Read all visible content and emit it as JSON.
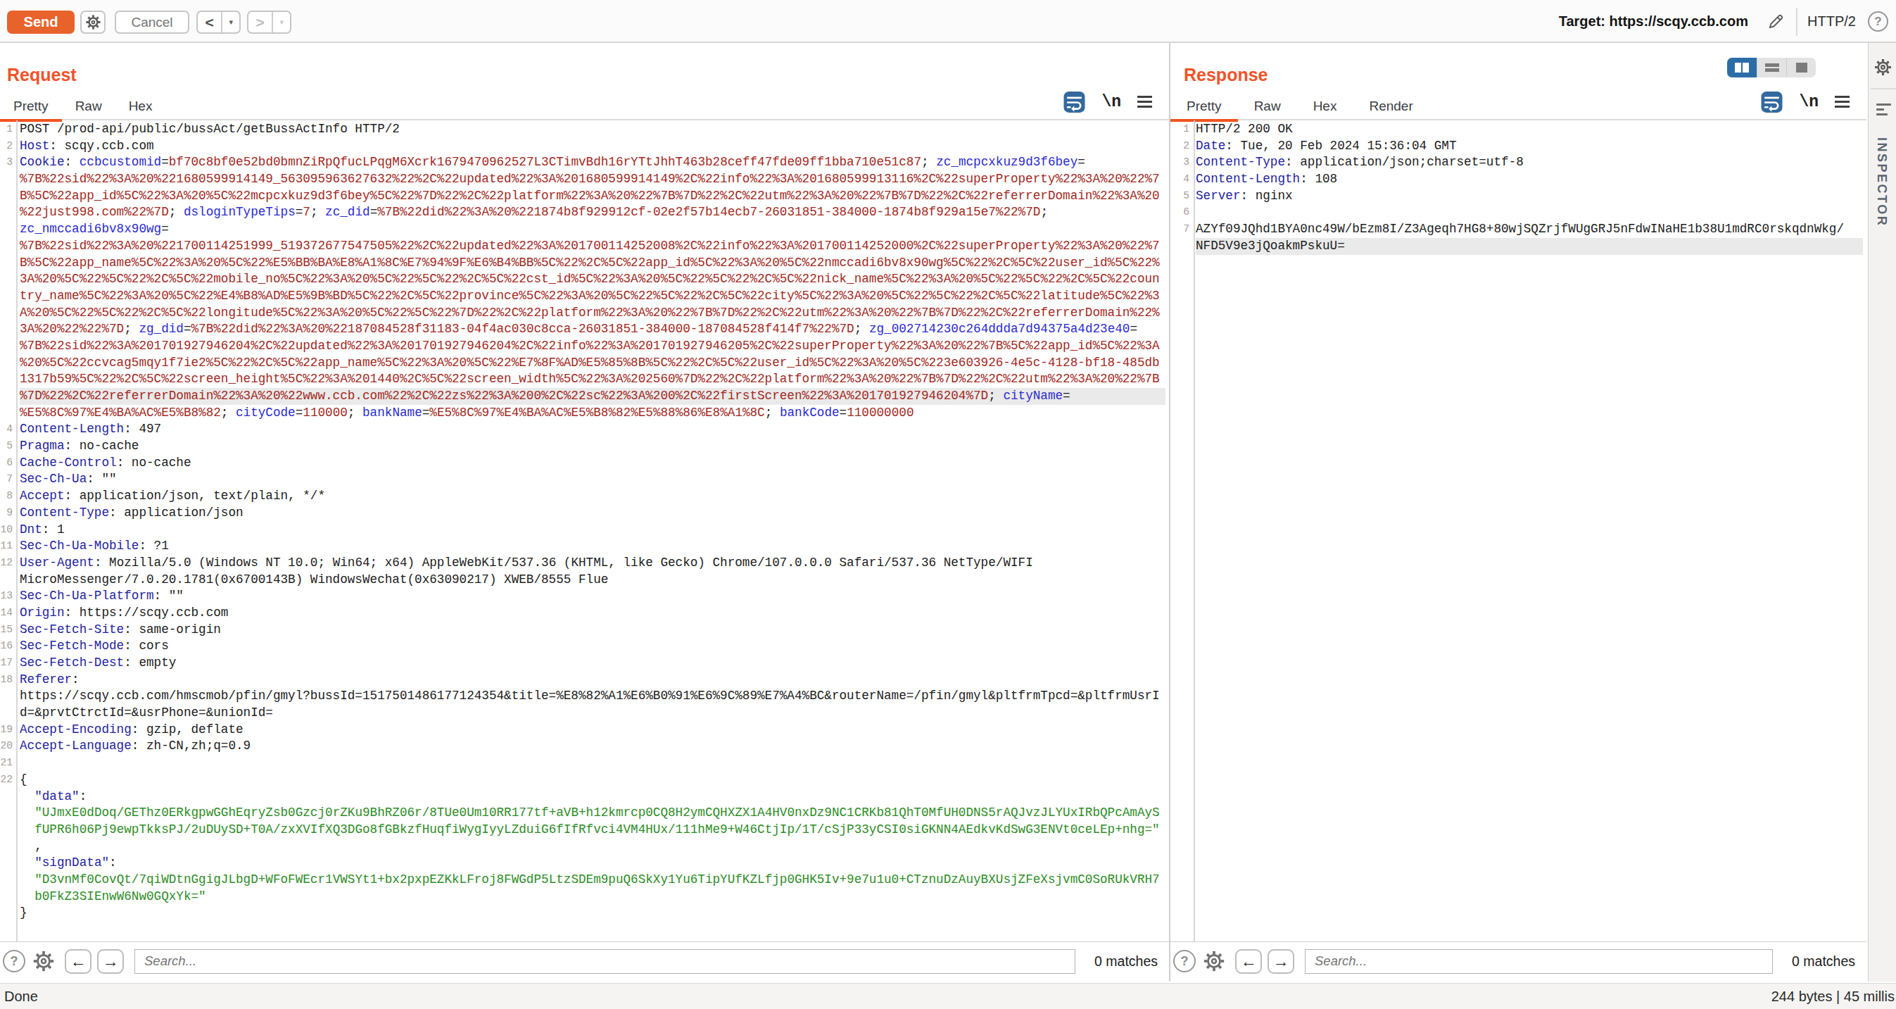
{
  "colors": {
    "accent_orange": "#f0542a",
    "send_button": "#e8632c",
    "tab_underline": "#f2551f",
    "active_toggle_blue": "#2c6da6",
    "wrap_icon_blue": "#33699d",
    "header_name_blue": "#24249f",
    "cookie_name_blue": "#2b2bd0",
    "value_red": "#a3291e",
    "string_green": "#2e8d27",
    "row_highlight": "#eaeaea"
  },
  "toolbar": {
    "send_label": "Send",
    "cancel_label": "Cancel",
    "back_glyph": "<",
    "forward_glyph": ">",
    "caret_glyph": "▾",
    "target_label": "Target: https://scqy.ccb.com",
    "protocol": "HTTP/2",
    "help_glyph": "?"
  },
  "inspector": {
    "label": "INSPECTOR"
  },
  "search": {
    "placeholder": "Search...",
    "matches": "0 matches",
    "help_glyph": "?",
    "prev_glyph": "←",
    "next_glyph": "→"
  },
  "status": {
    "left": "Done",
    "right": "244 bytes | 45 millis"
  },
  "request": {
    "title": "Request",
    "tabs": [
      "Pretty",
      "Raw",
      "Hex"
    ],
    "active_tab": "Pretty",
    "nl_icon": "\\n",
    "lines": [
      {
        "num": "1",
        "rows": [
          [
            {
              "c": "t",
              "x": "POST /prod-api/public/bussAct/getBussActInfo HTTP/2"
            }
          ]
        ]
      },
      {
        "num": "2",
        "rows": [
          [
            {
              "c": "h",
              "x": "Host"
            },
            {
              "c": "t",
              "x": ": scqy.ccb.com"
            }
          ]
        ]
      },
      {
        "num": "3",
        "rows": [
          [
            {
              "c": "h",
              "x": "Cookie"
            },
            {
              "c": "t",
              "x": ": "
            },
            {
              "c": "k",
              "x": "ccbcustomid"
            },
            {
              "c": "t",
              "x": "="
            },
            {
              "c": "v",
              "x": "bf70c8bf0e52bd0bmnZiRpQfucLPqgM6Xcrk1679470962527L3CTimvBdh16rYTtJhhT463b28ceff47fde09ff1bba710e51c87"
            },
            {
              "c": "t",
              "x": "; "
            },
            {
              "c": "k",
              "x": "zc_mcpcxkuz9d3f6bey"
            },
            {
              "c": "t",
              "x": "="
            }
          ],
          [
            {
              "c": "v",
              "x": "%7B%22sid%22%3A%20%221680599914149_563095963627632%22%2C%22updated%22%3A%201680599914149%2C%22info%22%3A%201680599913116%2C%22superProperty%22%3A%20%22%7"
            }
          ],
          [
            {
              "c": "v",
              "x": "B%5C%22app_id%5C%22%3A%20%5C%22mcpcxkuz9d3f6bey%5C%22%7D%22%2C%22platform%22%3A%20%22%7B%7D%22%2C%22utm%22%3A%20%22%7B%7D%22%2C%22referrerDomain%22%3A%20"
            }
          ],
          [
            {
              "c": "v",
              "x": "%22just998.com%22%7D"
            },
            {
              "c": "t",
              "x": "; "
            },
            {
              "c": "k",
              "x": "dsloginTypeTips"
            },
            {
              "c": "t",
              "x": "="
            },
            {
              "c": "v",
              "x": "7"
            },
            {
              "c": "t",
              "x": "; "
            },
            {
              "c": "k",
              "x": "zc_did"
            },
            {
              "c": "t",
              "x": "="
            },
            {
              "c": "v",
              "x": "%7B%22did%22%3A%20%221874b8f929912cf-02e2f57b14ecb7-26031851-384000-1874b8f929a15e7%22%7D"
            },
            {
              "c": "t",
              "x": ";"
            }
          ],
          [
            {
              "c": "k",
              "x": "zc_nmccadi6bv8x90wg"
            },
            {
              "c": "t",
              "x": "="
            }
          ],
          [
            {
              "c": "v",
              "x": "%7B%22sid%22%3A%20%221700114251999_519372677547505%22%2C%22updated%22%3A%201700114252008%2C%22info%22%3A%201700114252000%2C%22superProperty%22%3A%20%22%7"
            }
          ],
          [
            {
              "c": "v",
              "x": "B%5C%22app_name%5C%22%3A%20%5C%22%E5%BB%BA%E8%A1%8C%E7%94%9F%E6%B4%BB%5C%22%2C%5C%22app_id%5C%22%3A%20%5C%22nmccadi6bv8x90wg%5C%22%2C%5C%22user_id%5C%22%"
            }
          ],
          [
            {
              "c": "v",
              "x": "3A%20%5C%22%5C%22%2C%5C%22mobile_no%5C%22%3A%20%5C%22%5C%22%2C%5C%22cst_id%5C%22%3A%20%5C%22%5C%22%2C%5C%22nick_name%5C%22%3A%20%5C%22%5C%22%2C%5C%22coun"
            }
          ],
          [
            {
              "c": "v",
              "x": "try_name%5C%22%3A%20%5C%22%E4%B8%AD%E5%9B%BD%5C%22%2C%5C%22province%5C%22%3A%20%5C%22%5C%22%2C%5C%22city%5C%22%3A%20%5C%22%5C%22%2C%5C%22latitude%5C%22%3"
            }
          ],
          [
            {
              "c": "v",
              "x": "A%20%5C%22%5C%22%2C%5C%22longitude%5C%22%3A%20%5C%22%5C%22%7D%22%2C%22platform%22%3A%20%22%7B%7D%22%2C%22utm%22%3A%20%22%7B%7D%22%2C%22referrerDomain%22%"
            }
          ],
          [
            {
              "c": "v",
              "x": "3A%20%22%22%7D"
            },
            {
              "c": "t",
              "x": "; "
            },
            {
              "c": "k",
              "x": "zg_did"
            },
            {
              "c": "t",
              "x": "="
            },
            {
              "c": "v",
              "x": "%7B%22did%22%3A%20%22187084528f31183-04f4ac030c8cca-26031851-384000-187084528f414f7%22%7D"
            },
            {
              "c": "t",
              "x": "; "
            },
            {
              "c": "k",
              "x": "zg_002714230c264ddda7d94375a4d23e40"
            },
            {
              "c": "t",
              "x": "="
            }
          ],
          [
            {
              "c": "v",
              "x": "%7B%22sid%22%3A%201701927946204%2C%22updated%22%3A%201701927946204%2C%22info%22%3A%201701927946205%2C%22superProperty%22%3A%20%22%7B%5C%22app_id%5C%22%3A"
            }
          ],
          [
            {
              "c": "v",
              "x": "%20%5C%22ccvcag5mqy1f7ie2%5C%22%2C%5C%22app_name%5C%22%3A%20%5C%22%E7%8F%AD%E5%85%8B%5C%22%2C%5C%22user_id%5C%22%3A%20%5C%223e603926-4e5c-4128-bf18-485db"
            }
          ],
          [
            {
              "c": "v",
              "x": "1317b59%5C%22%2C%5C%22screen_height%5C%22%3A%201440%2C%5C%22screen_width%5C%22%3A%202560%7D%22%2C%22platform%22%3A%20%22%7B%7D%22%2C%22utm%22%3A%20%22%7B"
            }
          ],
          {
            "hl": true,
            "s": [
              {
                "c": "v",
                "x": "%7D%22%2C%22referrerDomain%22%3A%20%22www.ccb.com%22%2C%22zs%22%3A%200%2C%22sc%22%3A%200%2C%22firstScreen%22%3A%201701927946204%7D"
              },
              {
                "c": "t",
                "x": "; "
              },
              {
                "c": "k",
                "x": "cityName"
              },
              {
                "c": "t",
                "x": "="
              }
            ]
          },
          [
            {
              "c": "v",
              "x": "%E5%8C%97%E4%BA%AC%E5%B8%82"
            },
            {
              "c": "t",
              "x": "; "
            },
            {
              "c": "k",
              "x": "cityCode"
            },
            {
              "c": "t",
              "x": "="
            },
            {
              "c": "v",
              "x": "110000"
            },
            {
              "c": "t",
              "x": "; "
            },
            {
              "c": "k",
              "x": "bankName"
            },
            {
              "c": "t",
              "x": "="
            },
            {
              "c": "v",
              "x": "%E5%8C%97%E4%BA%AC%E5%B8%82%E5%88%86%E8%A1%8C"
            },
            {
              "c": "t",
              "x": "; "
            },
            {
              "c": "k",
              "x": "bankCode"
            },
            {
              "c": "t",
              "x": "="
            },
            {
              "c": "v",
              "x": "110000000"
            }
          ]
        ]
      },
      {
        "num": "4",
        "rows": [
          [
            {
              "c": "h",
              "x": "Content-Length"
            },
            {
              "c": "t",
              "x": ": 497"
            }
          ]
        ]
      },
      {
        "num": "5",
        "rows": [
          [
            {
              "c": "h",
              "x": "Pragma"
            },
            {
              "c": "t",
              "x": ": no-cache"
            }
          ]
        ]
      },
      {
        "num": "6",
        "rows": [
          [
            {
              "c": "h",
              "x": "Cache-Control"
            },
            {
              "c": "t",
              "x": ": no-cache"
            }
          ]
        ]
      },
      {
        "num": "7",
        "rows": [
          [
            {
              "c": "h",
              "x": "Sec-Ch-Ua"
            },
            {
              "c": "t",
              "x": ": \"\""
            }
          ]
        ]
      },
      {
        "num": "8",
        "rows": [
          [
            {
              "c": "h",
              "x": "Accept"
            },
            {
              "c": "t",
              "x": ": application/json, text/plain, */*"
            }
          ]
        ]
      },
      {
        "num": "9",
        "rows": [
          [
            {
              "c": "h",
              "x": "Content-Type"
            },
            {
              "c": "t",
              "x": ": application/json"
            }
          ]
        ]
      },
      {
        "num": "10",
        "rows": [
          [
            {
              "c": "h",
              "x": "Dnt"
            },
            {
              "c": "t",
              "x": ": 1"
            }
          ]
        ]
      },
      {
        "num": "11",
        "rows": [
          [
            {
              "c": "h",
              "x": "Sec-Ch-Ua-Mobile"
            },
            {
              "c": "t",
              "x": ": ?1"
            }
          ]
        ]
      },
      {
        "num": "12",
        "rows": [
          [
            {
              "c": "h",
              "x": "User-Agent"
            },
            {
              "c": "t",
              "x": ": Mozilla/5.0 (Windows NT 10.0; Win64; x64) AppleWebKit/537.36 (KHTML, like Gecko) Chrome/107.0.0.0 Safari/537.36 NetType/WIFI"
            }
          ],
          [
            {
              "c": "t",
              "x": "MicroMessenger/7.0.20.1781(0x6700143B) WindowsWechat(0x63090217) XWEB/8555 Flue"
            }
          ]
        ]
      },
      {
        "num": "13",
        "rows": [
          [
            {
              "c": "h",
              "x": "Sec-Ch-Ua-Platform"
            },
            {
              "c": "t",
              "x": ": \"\""
            }
          ]
        ]
      },
      {
        "num": "14",
        "rows": [
          [
            {
              "c": "h",
              "x": "Origin"
            },
            {
              "c": "t",
              "x": ": https://scqy.ccb.com"
            }
          ]
        ]
      },
      {
        "num": "15",
        "rows": [
          [
            {
              "c": "h",
              "x": "Sec-Fetch-Site"
            },
            {
              "c": "t",
              "x": ": same-origin"
            }
          ]
        ]
      },
      {
        "num": "16",
        "rows": [
          [
            {
              "c": "h",
              "x": "Sec-Fetch-Mode"
            },
            {
              "c": "t",
              "x": ": cors"
            }
          ]
        ]
      },
      {
        "num": "17",
        "rows": [
          [
            {
              "c": "h",
              "x": "Sec-Fetch-Dest"
            },
            {
              "c": "t",
              "x": ": empty"
            }
          ]
        ]
      },
      {
        "num": "18",
        "rows": [
          [
            {
              "c": "h",
              "x": "Referer"
            },
            {
              "c": "t",
              "x": ": "
            }
          ],
          [
            {
              "c": "t",
              "x": "https://scqy.ccb.com/hmscmob/pfin/gmyl?bussId=1517501486177124354&title=%E8%82%A1%E6%B0%91%E6%9C%89%E7%A4%BC&routerName=/pfin/gmyl&pltfrmTpcd=&pltfrmUsrI"
            }
          ],
          [
            {
              "c": "t",
              "x": "d=&prvtCtrctId=&usrPhone=&unionId="
            }
          ]
        ]
      },
      {
        "num": "19",
        "rows": [
          [
            {
              "c": "h",
              "x": "Accept-Encoding"
            },
            {
              "c": "t",
              "x": ": gzip, deflate"
            }
          ]
        ]
      },
      {
        "num": "20",
        "rows": [
          [
            {
              "c": "h",
              "x": "Accept-Language"
            },
            {
              "c": "t",
              "x": ": zh-CN,zh;q=0.9"
            }
          ]
        ]
      },
      {
        "num": "21",
        "rows": [
          []
        ]
      },
      {
        "num": "22",
        "rows": [
          [
            {
              "c": "t",
              "x": "{"
            }
          ],
          [
            {
              "c": "t",
              "x": "  "
            },
            {
              "c": "j",
              "x": "\"data\""
            },
            {
              "c": "t",
              "x": ":"
            }
          ],
          [
            {
              "c": "t",
              "x": "  "
            },
            {
              "c": "g",
              "x": "\"UJmxE0dDoq/GEThz0ERkgpwGGhEqryZsb0Gzcj0rZKu9BhRZ06r/8TUe0Um10RR177tf+aVB+h12kmrcp0CQ8H2ymCQHXZX1A4HV0nxDz9NC1CRKb81QhT0MfUH0DNS5rAQJvzJLYUxIRbQPcAmAyS"
            }
          ],
          [
            {
              "c": "t",
              "x": "  "
            },
            {
              "c": "g",
              "x": "fUPR6h06Pj9ewpTkksPJ/2uDUySD+T0A/zxXVIfXQ3DGo8fGBkzfHuqfiWygIyyLZduiG6fIfRfvci4VM4HUx/111hMe9+W46CtjIp/1T/cSjP33yCSI0siGKNN4AEdkvKdSwG3ENVt0ceLEp+nhg=\""
            }
          ],
          [
            {
              "c": "t",
              "x": "  ,"
            }
          ],
          [
            {
              "c": "t",
              "x": "  "
            },
            {
              "c": "j",
              "x": "\"signData\""
            },
            {
              "c": "t",
              "x": ":"
            }
          ],
          [
            {
              "c": "t",
              "x": "  "
            },
            {
              "c": "g",
              "x": "\"D3vnMf0CovQt/7qiWDtnGgigJLbgD+WFoFWEcr1VWSYt1+bx2pxpEZKkLFroj8FWGdP5LtzSDEm9puQ6SkXy1Yu6TipYUfKZLfjp0GHK5Iv+9e7u1u0+CTznuDzAuyBXUsjZFeXsjvmC0SoRUkVRH7"
            }
          ],
          [
            {
              "c": "t",
              "x": "  "
            },
            {
              "c": "g",
              "x": "b0FkZ3SIEnwW6Nw0GQxYk=\""
            }
          ],
          [
            {
              "c": "t",
              "x": "}"
            }
          ]
        ]
      }
    ]
  },
  "response": {
    "title": "Response",
    "tabs": [
      "Pretty",
      "Raw",
      "Hex",
      "Render"
    ],
    "active_tab": "Pretty",
    "nl_icon": "\\n",
    "lines": [
      {
        "num": "1",
        "rows": [
          [
            {
              "c": "t",
              "x": "HTTP/2 200 OK"
            }
          ]
        ]
      },
      {
        "num": "2",
        "rows": [
          [
            {
              "c": "h",
              "x": "Date"
            },
            {
              "c": "t",
              "x": ": Tue, 20 Feb 2024 15:36:04 GMT"
            }
          ]
        ]
      },
      {
        "num": "3",
        "rows": [
          [
            {
              "c": "h",
              "x": "Content-Type"
            },
            {
              "c": "t",
              "x": ": application/json;charset=utf-8"
            }
          ]
        ]
      },
      {
        "num": "4",
        "rows": [
          [
            {
              "c": "h",
              "x": "Content-Length"
            },
            {
              "c": "t",
              "x": ": 108"
            }
          ]
        ]
      },
      {
        "num": "5",
        "rows": [
          [
            {
              "c": "h",
              "x": "Server"
            },
            {
              "c": "t",
              "x": ": nginx"
            }
          ]
        ]
      },
      {
        "num": "6",
        "rows": [
          []
        ]
      },
      {
        "num": "7",
        "rows": [
          [
            {
              "c": "t",
              "x": "AZYf09JQhd1BYA0nc49W/bEzm8I/Z3Ageqh7HG8+80wjSQZrjfWUgGRJ5nFdwINaHE1b38U1mdRC0rskqdnWkg/"
            }
          ],
          {
            "hl": true,
            "s": [
              {
                "c": "t",
                "x": "NFD5V9e3jQoakmPskuU="
              }
            ]
          }
        ]
      }
    ]
  }
}
